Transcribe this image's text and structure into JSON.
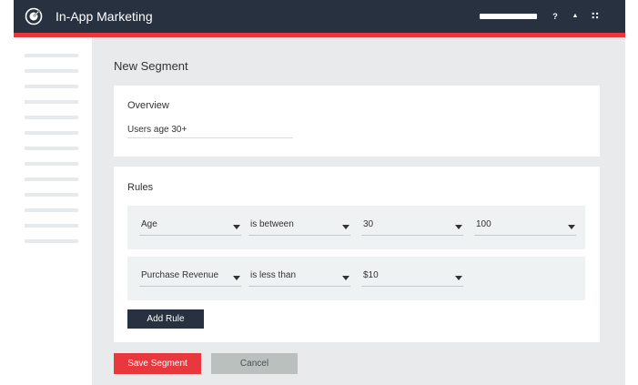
{
  "app": {
    "title": "In-App Marketing",
    "logo_icon": "target-icon",
    "header_icons": [
      "help-icon",
      "user-icon",
      "apps-grid-icon"
    ],
    "header_icon_glyphs": {
      "help": "?",
      "user": "▲",
      "apps": "∷"
    }
  },
  "sidebar": {
    "items": [
      "",
      "",
      "",
      "",
      "",
      "",
      "",
      "",
      "",
      "",
      "",
      "",
      ""
    ]
  },
  "page": {
    "title": "New Segment"
  },
  "overview": {
    "heading": "Overview",
    "segment_name": "Users age 30+"
  },
  "rules": {
    "heading": "Rules",
    "rows": [
      {
        "field": "Age",
        "operator": "is between",
        "value": "30",
        "value2": "100"
      },
      {
        "field": "Purchase Revenue",
        "operator": "is less than",
        "value": "$10"
      }
    ],
    "add_rule_label": "Add Rule"
  },
  "actions": {
    "save_label": "Save Segment",
    "cancel_label": "Cancel"
  },
  "colors": {
    "header_bg": "#283140",
    "accent": "#e8383d",
    "content_bg": "#e8eaeb",
    "rule_row_bg": "#eff2f2",
    "cancel_bg": "#b9c0be"
  }
}
